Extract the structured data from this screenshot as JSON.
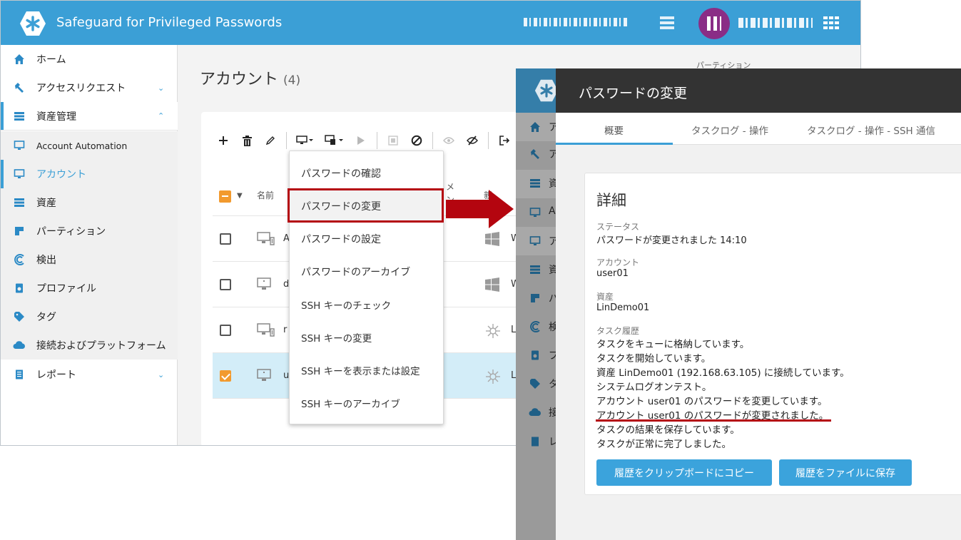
{
  "app": {
    "title": "Safeguard for Privileged Passwords"
  },
  "sidebar": {
    "items": [
      {
        "label": "ホーム",
        "icon": "home-icon"
      },
      {
        "label": "アクセスリクエスト",
        "icon": "wrench-icon",
        "chevron": "⌄"
      },
      {
        "label": "資産管理",
        "icon": "server-icon",
        "chevron": "⌃"
      },
      {
        "label": "Account Automation",
        "icon": "monitor-icon"
      },
      {
        "label": "アカウント",
        "icon": "monitor-icon"
      },
      {
        "label": "資産",
        "icon": "server-icon"
      },
      {
        "label": "パーティション",
        "icon": "partition-icon"
      },
      {
        "label": "検出",
        "icon": "discovery-icon"
      },
      {
        "label": "プロファイル",
        "icon": "profile-icon"
      },
      {
        "label": "タグ",
        "icon": "tag-icon"
      },
      {
        "label": "接続およびプラットフォーム",
        "icon": "cloud-icon"
      },
      {
        "label": "レポート",
        "icon": "report-icon",
        "chevron": "⌄"
      }
    ]
  },
  "main": {
    "page_title": "アカウント",
    "count": "(4)",
    "partition_label": "パーティション",
    "header": {
      "name": "名前",
      "col_frag_1": "メ",
      "col_frag_2": "ン",
      "col_frag_3": "親"
    },
    "rows": [
      {
        "text": "A",
        "os": "W",
        "os_icon": "windows-icon",
        "checked": false
      },
      {
        "text": "d",
        "os": "W",
        "os_icon": "windows-icon",
        "checked": false
      },
      {
        "text": "r",
        "os": "L",
        "os_icon": "linux-icon",
        "checked": false
      },
      {
        "text": "u",
        "os": "L",
        "os_icon": "linux-icon",
        "checked": true
      }
    ]
  },
  "dropdown": {
    "items": [
      "パスワードの確認",
      "パスワードの変更",
      "パスワードの設定",
      "パスワードのアーカイブ",
      "SSH キーのチェック",
      "SSH キーの変更",
      "SSH キーを表示または設定",
      "SSH キーのアーカイブ"
    ],
    "highlighted_index": 1
  },
  "panel": {
    "title": "パスワードの変更",
    "tabs": [
      "概要",
      "タスクログ - 操作",
      "タスクログ - 操作 - SSH 通信"
    ],
    "sidebar_fragments": [
      "ア",
      "ア",
      "資",
      "A",
      "ア",
      "資",
      "パ",
      "検",
      "プ",
      "タ",
      "接",
      "レ"
    ],
    "details": {
      "title": "詳細",
      "status_label": "ステータス",
      "status_value": "パスワードが変更されました 14:10",
      "account_label": "アカウント",
      "account_value": "user01",
      "asset_label": "資産",
      "asset_value": "LinDemo01",
      "history_label": "タスク履歴",
      "history": [
        "タスクをキューに格納しています。",
        "タスクを開始しています。",
        "資産 LinDemo01 (192.168.63.105) に接続しています。",
        "システムログオンテスト。",
        "アカウント user01 のパスワードを変更しています。",
        "アカウント user01 のパスワードが変更されました。",
        "タスクの結果を保存しています。",
        "タスクが正常に完了しました。"
      ],
      "copy_button": "履歴をクリップボードにコピー",
      "save_button": "履歴をファイルに保存"
    }
  },
  "colors": {
    "brand_blue": "#3b9fd6",
    "accent_orange": "#f29a2e",
    "highlight_red": "#b4050f",
    "panel_header": "#333333"
  }
}
